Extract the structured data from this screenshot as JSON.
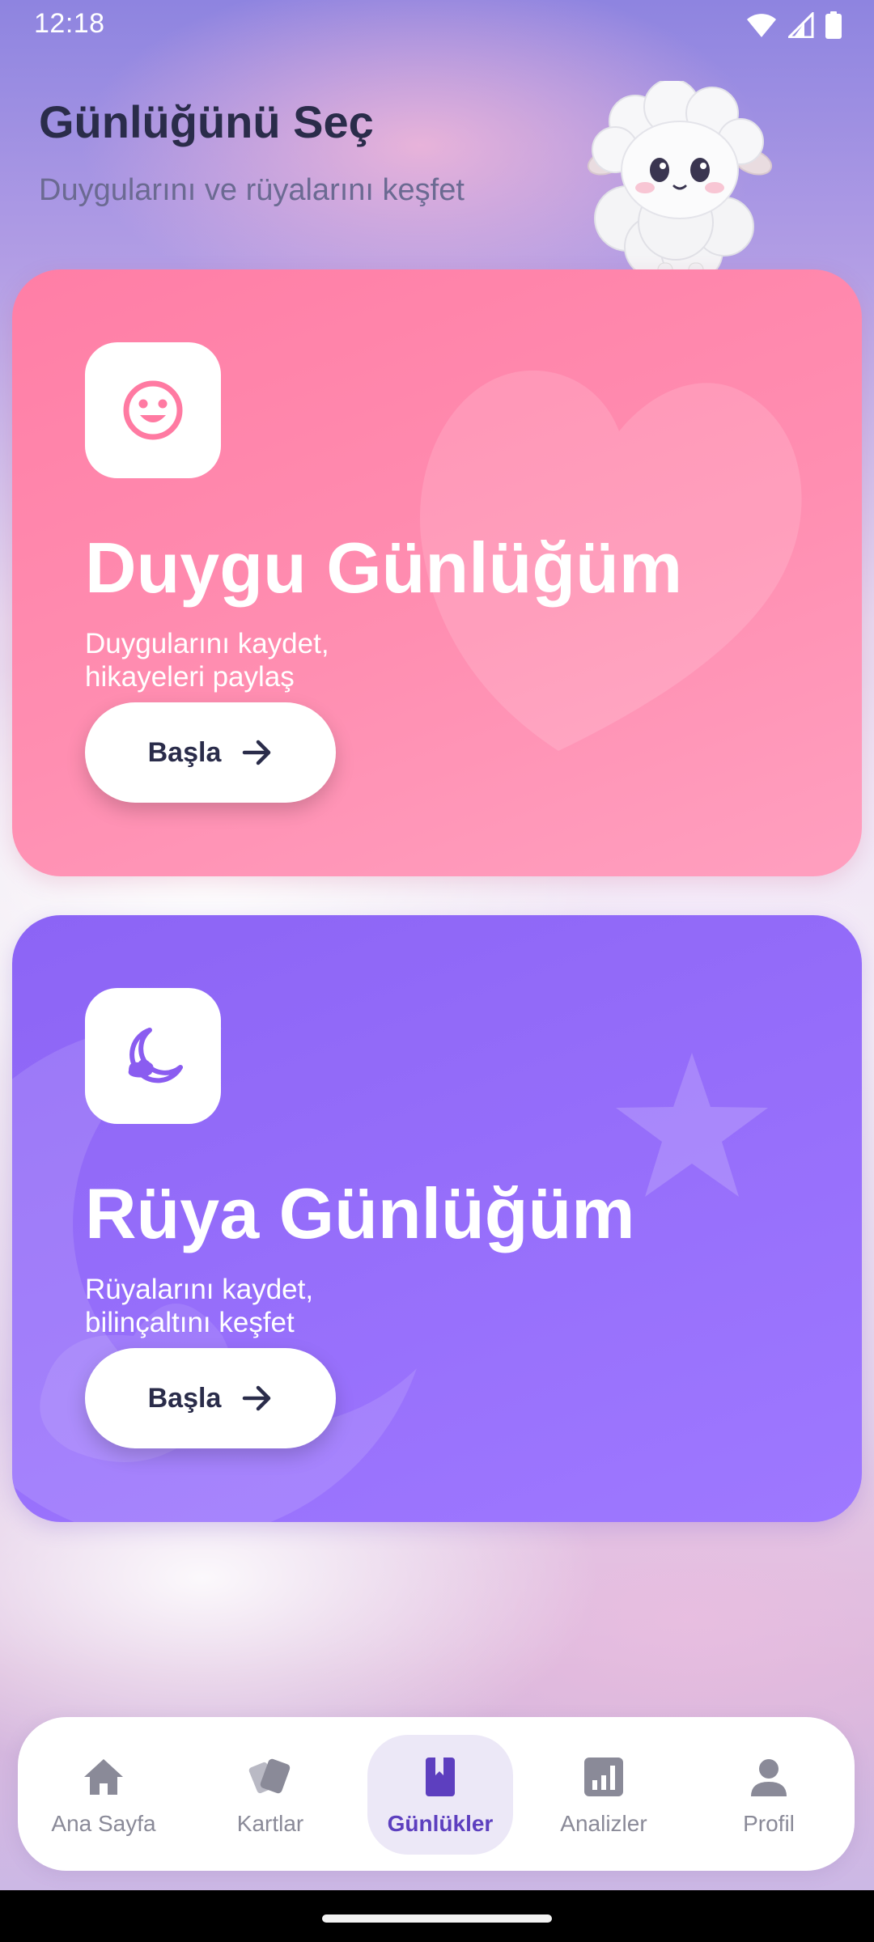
{
  "status_bar": {
    "time": "12:18",
    "icons": [
      "wifi-icon",
      "signal-icon",
      "battery-icon"
    ]
  },
  "header": {
    "title": "Günlüğünü Seç",
    "subtitle": "Duygularını ve rüyalarını keşfet"
  },
  "mascot": {
    "icon": "sheep-mascot"
  },
  "cards": [
    {
      "id": "duygu",
      "icon": "smile-icon",
      "title": "Duygu Günlüğüm",
      "desc_line1": "Duygularını kaydet,",
      "desc_line2": "hikayeleri paylaş",
      "button_label": "Başla",
      "color": "#ff86ad"
    },
    {
      "id": "ruya",
      "icon": "moon-icon",
      "title": "Rüya Günlüğüm",
      "desc_line1": "Rüyalarını kaydet,",
      "desc_line2": "bilinçaltını keşfet",
      "button_label": "Başla",
      "color": "#9670fb"
    }
  ],
  "nav": {
    "active": "Günlükler",
    "items": [
      {
        "label": "Ana Sayfa",
        "icon": "home-icon"
      },
      {
        "label": "Kartlar",
        "icon": "cards-icon"
      },
      {
        "label": "Günlükler",
        "icon": "book-icon"
      },
      {
        "label": "Analizler",
        "icon": "chart-icon"
      },
      {
        "label": "Profil",
        "icon": "person-icon"
      }
    ]
  },
  "colors": {
    "title": "#2a2c4a",
    "subtitle": "#6b6a92",
    "accent": "#5d3fbf",
    "nav_inactive": "#8a8a98"
  }
}
